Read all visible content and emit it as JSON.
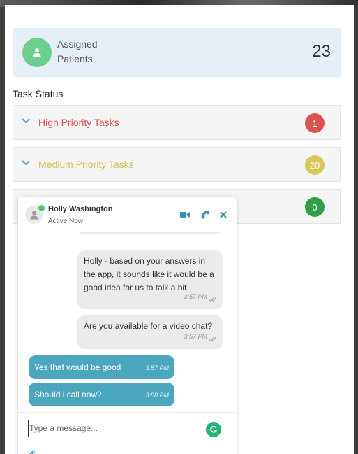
{
  "assigned": {
    "label": "Assigned Patients",
    "count": "23"
  },
  "task_status": {
    "title": "Task Status",
    "rows": [
      {
        "label": "High Priority Tasks",
        "count": "1",
        "color": "#d9534f",
        "badge_color": "#d9534f"
      },
      {
        "label": "Medium Priority Tasks",
        "count": "20",
        "color": "#d2c052",
        "badge_color": "#d8c85a"
      },
      {
        "label": "",
        "count": "0",
        "color": "#3aa655",
        "badge_color": "#2f9e45"
      }
    ]
  },
  "chat": {
    "contact_name": "Holly Washington",
    "contact_status": "Active Now",
    "icons": [
      "video-icon",
      "phone-icon",
      "close-icon"
    ],
    "messages": [
      {
        "direction": "out",
        "text": "Holly - based on your answers in the app, it sounds like it would be a good idea for us to talk a bit.",
        "time": "3:57 PM",
        "read": true
      },
      {
        "direction": "out",
        "text": "Are you available for a video chat?",
        "time": "3:57 PM",
        "read": true
      },
      {
        "direction": "in",
        "text": "Yes that would be good",
        "time": "3:57 PM"
      },
      {
        "direction": "in",
        "text": "Should i call now?",
        "time": "3:58 PM"
      }
    ],
    "composer": {
      "placeholder": "Type a message...",
      "value": ""
    }
  },
  "colors": {
    "accent": "#4aa7bd",
    "online": "#4cca6e",
    "avatar": "#6ccf8e"
  }
}
